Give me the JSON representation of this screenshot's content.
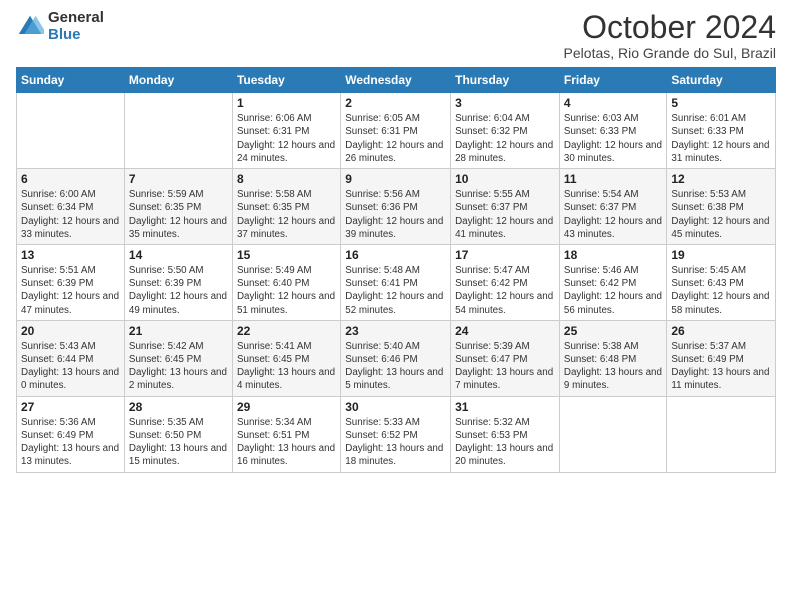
{
  "logo": {
    "general": "General",
    "blue": "Blue"
  },
  "title": "October 2024",
  "subtitle": "Pelotas, Rio Grande do Sul, Brazil",
  "weekdays": [
    "Sunday",
    "Monday",
    "Tuesday",
    "Wednesday",
    "Thursday",
    "Friday",
    "Saturday"
  ],
  "weeks": [
    [
      {
        "day": "",
        "info": ""
      },
      {
        "day": "",
        "info": ""
      },
      {
        "day": "1",
        "info": "Sunrise: 6:06 AM\nSunset: 6:31 PM\nDaylight: 12 hours and 24 minutes."
      },
      {
        "day": "2",
        "info": "Sunrise: 6:05 AM\nSunset: 6:31 PM\nDaylight: 12 hours and 26 minutes."
      },
      {
        "day": "3",
        "info": "Sunrise: 6:04 AM\nSunset: 6:32 PM\nDaylight: 12 hours and 28 minutes."
      },
      {
        "day": "4",
        "info": "Sunrise: 6:03 AM\nSunset: 6:33 PM\nDaylight: 12 hours and 30 minutes."
      },
      {
        "day": "5",
        "info": "Sunrise: 6:01 AM\nSunset: 6:33 PM\nDaylight: 12 hours and 31 minutes."
      }
    ],
    [
      {
        "day": "6",
        "info": "Sunrise: 6:00 AM\nSunset: 6:34 PM\nDaylight: 12 hours and 33 minutes."
      },
      {
        "day": "7",
        "info": "Sunrise: 5:59 AM\nSunset: 6:35 PM\nDaylight: 12 hours and 35 minutes."
      },
      {
        "day": "8",
        "info": "Sunrise: 5:58 AM\nSunset: 6:35 PM\nDaylight: 12 hours and 37 minutes."
      },
      {
        "day": "9",
        "info": "Sunrise: 5:56 AM\nSunset: 6:36 PM\nDaylight: 12 hours and 39 minutes."
      },
      {
        "day": "10",
        "info": "Sunrise: 5:55 AM\nSunset: 6:37 PM\nDaylight: 12 hours and 41 minutes."
      },
      {
        "day": "11",
        "info": "Sunrise: 5:54 AM\nSunset: 6:37 PM\nDaylight: 12 hours and 43 minutes."
      },
      {
        "day": "12",
        "info": "Sunrise: 5:53 AM\nSunset: 6:38 PM\nDaylight: 12 hours and 45 minutes."
      }
    ],
    [
      {
        "day": "13",
        "info": "Sunrise: 5:51 AM\nSunset: 6:39 PM\nDaylight: 12 hours and 47 minutes."
      },
      {
        "day": "14",
        "info": "Sunrise: 5:50 AM\nSunset: 6:39 PM\nDaylight: 12 hours and 49 minutes."
      },
      {
        "day": "15",
        "info": "Sunrise: 5:49 AM\nSunset: 6:40 PM\nDaylight: 12 hours and 51 minutes."
      },
      {
        "day": "16",
        "info": "Sunrise: 5:48 AM\nSunset: 6:41 PM\nDaylight: 12 hours and 52 minutes."
      },
      {
        "day": "17",
        "info": "Sunrise: 5:47 AM\nSunset: 6:42 PM\nDaylight: 12 hours and 54 minutes."
      },
      {
        "day": "18",
        "info": "Sunrise: 5:46 AM\nSunset: 6:42 PM\nDaylight: 12 hours and 56 minutes."
      },
      {
        "day": "19",
        "info": "Sunrise: 5:45 AM\nSunset: 6:43 PM\nDaylight: 12 hours and 58 minutes."
      }
    ],
    [
      {
        "day": "20",
        "info": "Sunrise: 5:43 AM\nSunset: 6:44 PM\nDaylight: 13 hours and 0 minutes."
      },
      {
        "day": "21",
        "info": "Sunrise: 5:42 AM\nSunset: 6:45 PM\nDaylight: 13 hours and 2 minutes."
      },
      {
        "day": "22",
        "info": "Sunrise: 5:41 AM\nSunset: 6:45 PM\nDaylight: 13 hours and 4 minutes."
      },
      {
        "day": "23",
        "info": "Sunrise: 5:40 AM\nSunset: 6:46 PM\nDaylight: 13 hours and 5 minutes."
      },
      {
        "day": "24",
        "info": "Sunrise: 5:39 AM\nSunset: 6:47 PM\nDaylight: 13 hours and 7 minutes."
      },
      {
        "day": "25",
        "info": "Sunrise: 5:38 AM\nSunset: 6:48 PM\nDaylight: 13 hours and 9 minutes."
      },
      {
        "day": "26",
        "info": "Sunrise: 5:37 AM\nSunset: 6:49 PM\nDaylight: 13 hours and 11 minutes."
      }
    ],
    [
      {
        "day": "27",
        "info": "Sunrise: 5:36 AM\nSunset: 6:49 PM\nDaylight: 13 hours and 13 minutes."
      },
      {
        "day": "28",
        "info": "Sunrise: 5:35 AM\nSunset: 6:50 PM\nDaylight: 13 hours and 15 minutes."
      },
      {
        "day": "29",
        "info": "Sunrise: 5:34 AM\nSunset: 6:51 PM\nDaylight: 13 hours and 16 minutes."
      },
      {
        "day": "30",
        "info": "Sunrise: 5:33 AM\nSunset: 6:52 PM\nDaylight: 13 hours and 18 minutes."
      },
      {
        "day": "31",
        "info": "Sunrise: 5:32 AM\nSunset: 6:53 PM\nDaylight: 13 hours and 20 minutes."
      },
      {
        "day": "",
        "info": ""
      },
      {
        "day": "",
        "info": ""
      }
    ]
  ]
}
